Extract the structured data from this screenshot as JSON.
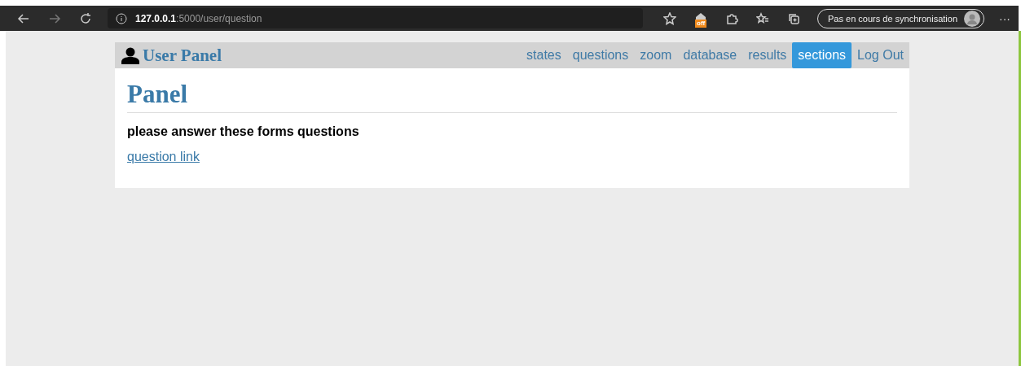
{
  "browser": {
    "url_host": "127.0.0.1",
    "url_path": ":5000/user/question",
    "extension_badge": "off",
    "sync_button": "Pas en cours de synchronisation",
    "more": "···"
  },
  "navbar": {
    "brand": "User Panel",
    "links": [
      {
        "label": "states",
        "selected": false
      },
      {
        "label": "questions",
        "selected": false
      },
      {
        "label": "zoom",
        "selected": false
      },
      {
        "label": "database",
        "selected": false
      },
      {
        "label": "results",
        "selected": false
      },
      {
        "label": "sections",
        "selected": true
      },
      {
        "label": "Log Out",
        "selected": false
      }
    ]
  },
  "content": {
    "heading": "Panel",
    "instruction": "please answer these forms questions",
    "link": "question link"
  }
}
